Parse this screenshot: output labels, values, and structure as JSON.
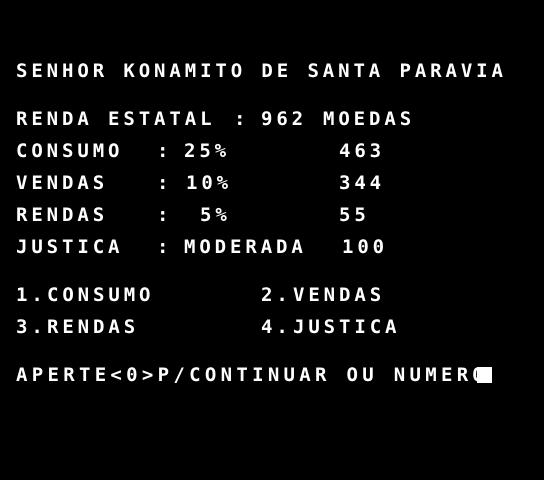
{
  "title": "SENHOR KONAMITO DE SANTA PARAVIA",
  "income": {
    "label": "RENDA ESTATAL",
    "sep": ":",
    "value": "962",
    "unit": "MOEDAS"
  },
  "taxes": [
    {
      "label": "CONSUMO",
      "sep": ":",
      "rate": "25%",
      "amount": "463"
    },
    {
      "label": "VENDAS",
      "sep": ":",
      "rate": "10%",
      "amount": "344"
    },
    {
      "label": "RENDAS",
      "sep": ":",
      "rate": "5%",
      "amount": "55"
    },
    {
      "label": "JUSTICA",
      "sep": ":",
      "rate": "MODERADA",
      "amount": "100"
    }
  ],
  "menu": [
    {
      "num": "1.",
      "label": "CONSUMO"
    },
    {
      "num": "2.",
      "label": "VENDAS"
    },
    {
      "num": "3.",
      "label": "RENDAS"
    },
    {
      "num": "4.",
      "label": "JUSTICA"
    }
  ],
  "prompt": "APERTE<0>P/CONTINUAR OU NUMERO",
  "colors": {
    "background": "#000000",
    "text": "#ffffff"
  }
}
